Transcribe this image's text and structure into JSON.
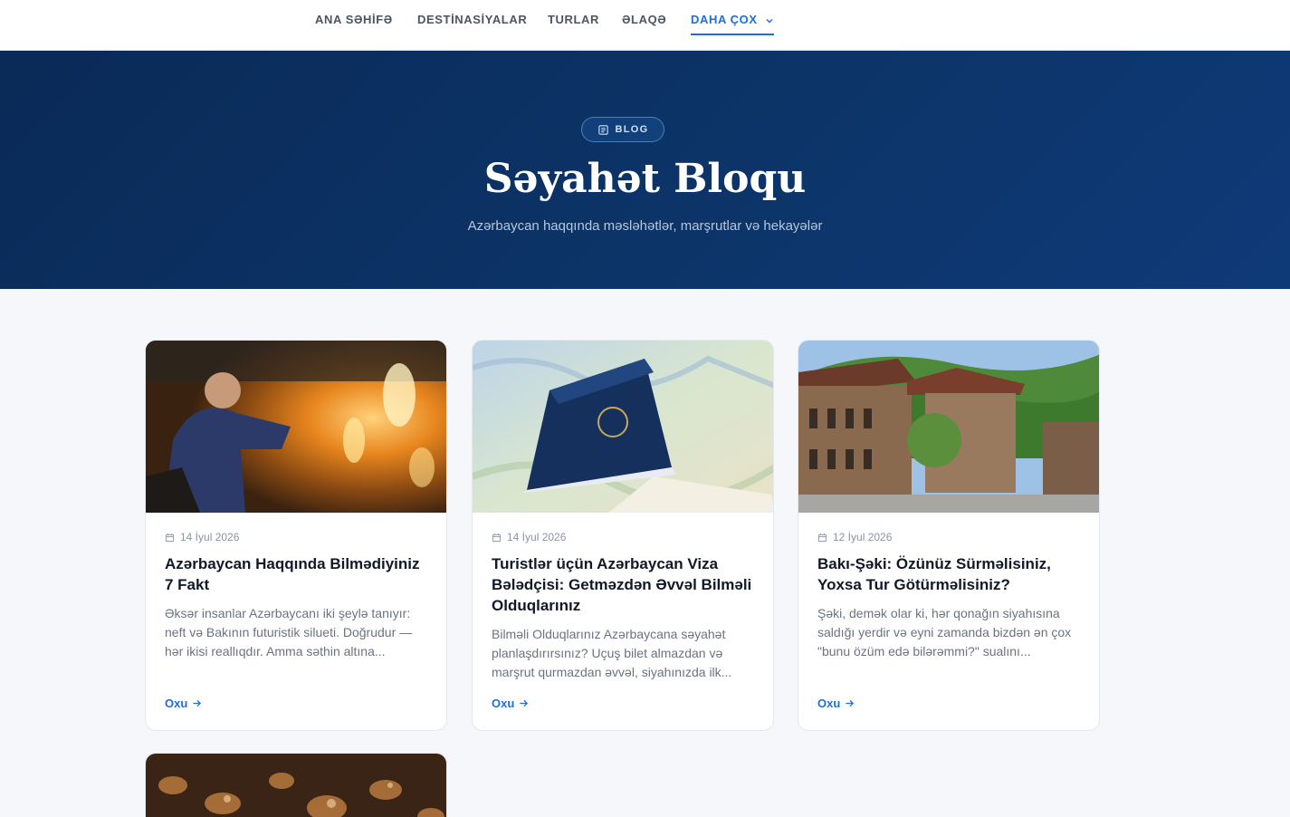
{
  "nav": {
    "items": [
      "ANA SƏHİFƏ",
      "DESTİNASİYALAR",
      "TURLAR",
      "ƏLAQƏ"
    ],
    "more_label": "DAHA ÇOX"
  },
  "hero": {
    "badge": "BLOG",
    "title": "Səyahət Bloqu",
    "subtitle": "Azərbaycan haqqında məsləhətlər, marşrutlar və hekayələr"
  },
  "posts": [
    {
      "date": "14 İyul 2026",
      "title": "Azərbaycan Haqqında Bilmədiyiniz 7 Fakt",
      "excerpt": "Əksər insanlar Azərbaycanı iki şeylə tanıyır: neft və Bakının futuristik silueti. Doğrudur — hər ikisi reallıqdır. Amma səthin altına...",
      "read_more": "Oxu"
    },
    {
      "date": "14 İyul 2026",
      "title": "Turistlər üçün Azərbaycan Viza Bələdçisi: Getməzdən Əvvəl Bilməli Olduqlarınız",
      "excerpt": "Bilməli Olduqlarınız Azərbaycana səyahət planlaşdırırsınız? Uçuş bilet almazdan və marşrut qurmazdan əvvəl, siyahınızda ilk...",
      "read_more": "Oxu"
    },
    {
      "date": "12 İyul 2026",
      "title": "Bakı-Şəki: Özünüz Sürməlisiniz, Yoxsa Tur Götürməlisiniz?",
      "excerpt": "Şəki, demək olar ki, hər qonağın siyahısına saldığı yerdir və eyni zamanda bizdən ən çox \"bunu özüm edə bilərəmmi?\" sualını...",
      "read_more": "Oxu"
    }
  ]
}
